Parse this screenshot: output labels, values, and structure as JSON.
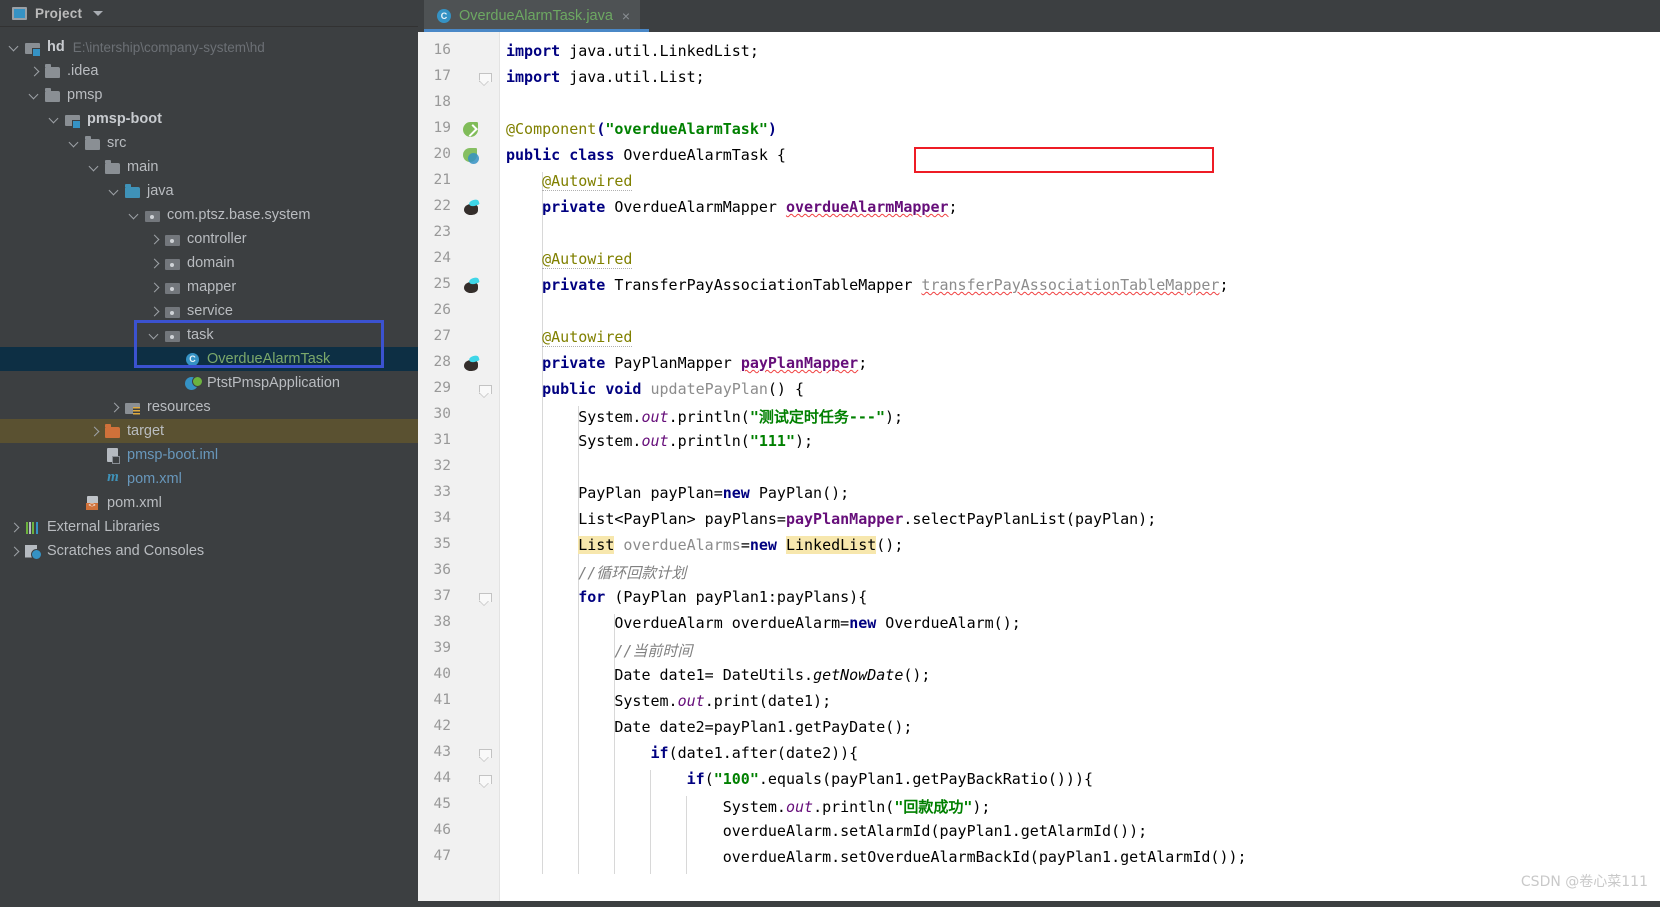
{
  "sidebar": {
    "header": {
      "title": "Project",
      "icon": "project-icon",
      "dropdown": "chevron-down-icon"
    },
    "annotation_color": "#3b52d0",
    "items": [
      {
        "label": "hd",
        "path": "E:\\intership\\company-system\\hd",
        "icon": "module-folder-icon",
        "indent": 0,
        "arrow": "open",
        "style": "bold"
      },
      {
        "label": ".idea",
        "path": "",
        "icon": "folder-icon",
        "indent": 1,
        "arrow": "closed",
        "style": "plain"
      },
      {
        "label": "pmsp",
        "path": "",
        "icon": "folder-icon",
        "indent": 1,
        "arrow": "open",
        "style": "plain"
      },
      {
        "label": "pmsp-boot",
        "path": "",
        "icon": "module-folder-icon",
        "indent": 2,
        "arrow": "open",
        "style": "bold"
      },
      {
        "label": "src",
        "path": "",
        "icon": "folder-icon",
        "indent": 3,
        "arrow": "open",
        "style": "plain"
      },
      {
        "label": "main",
        "path": "",
        "icon": "folder-icon",
        "indent": 4,
        "arrow": "open",
        "style": "plain"
      },
      {
        "label": "java",
        "path": "",
        "icon": "source-folder-icon",
        "indent": 5,
        "arrow": "open",
        "style": "plain"
      },
      {
        "label": "com.ptsz.base.system",
        "path": "",
        "icon": "package-icon",
        "indent": 6,
        "arrow": "open",
        "style": "plain"
      },
      {
        "label": "controller",
        "path": "",
        "icon": "package-icon",
        "indent": 7,
        "arrow": "closed",
        "style": "plain"
      },
      {
        "label": "domain",
        "path": "",
        "icon": "package-icon",
        "indent": 7,
        "arrow": "closed",
        "style": "plain"
      },
      {
        "label": "mapper",
        "path": "",
        "icon": "package-icon",
        "indent": 7,
        "arrow": "closed",
        "style": "plain"
      },
      {
        "label": "service",
        "path": "",
        "icon": "package-icon",
        "indent": 7,
        "arrow": "closed",
        "style": "plain"
      },
      {
        "label": "task",
        "path": "",
        "icon": "package-icon",
        "indent": 7,
        "arrow": "open",
        "style": "plain"
      },
      {
        "label": "OverdueAlarmTask",
        "path": "",
        "icon": "java-class-icon",
        "indent": 8,
        "arrow": "none",
        "style": "green-selected"
      },
      {
        "label": "PtstPmspApplication",
        "path": "",
        "icon": "spring-boot-class-icon",
        "indent": 8,
        "arrow": "none",
        "style": "plain"
      },
      {
        "label": "resources",
        "path": "",
        "icon": "resources-folder-icon",
        "indent": 5,
        "arrow": "closed",
        "style": "plain"
      },
      {
        "label": "target",
        "path": "",
        "icon": "excluded-folder-icon",
        "indent": 4,
        "arrow": "closed",
        "style": "excluded"
      },
      {
        "label": "pmsp-boot.iml",
        "path": "",
        "icon": "iml-file-icon",
        "indent": 4,
        "arrow": "none",
        "style": "blue"
      },
      {
        "label": "pom.xml",
        "path": "",
        "icon": "maven-icon",
        "indent": 4,
        "arrow": "none",
        "style": "blue"
      },
      {
        "label": "pom.xml",
        "path": "",
        "icon": "xml-file-icon",
        "indent": 3,
        "arrow": "none",
        "style": "plain"
      },
      {
        "label": "External Libraries",
        "path": "",
        "icon": "external-libraries-icon",
        "indent": 0,
        "arrow": "closed",
        "style": "plain"
      },
      {
        "label": "Scratches and Consoles",
        "path": "",
        "icon": "scratches-icon",
        "indent": 0,
        "arrow": "closed",
        "style": "plain"
      }
    ]
  },
  "editor": {
    "tab": {
      "title": "OverdueAlarmTask.java",
      "icon": "java-class-icon",
      "close": "×"
    },
    "annotation_color": "#ee1c25",
    "first_line": 16,
    "lines": [
      {
        "n": 16,
        "gutter": "",
        "fold": false,
        "html": "<span class=\"kw\">import</span><span class=\"pln\"> java.util.LinkedList;</span>"
      },
      {
        "n": 17,
        "gutter": "",
        "fold": true,
        "html": "<span class=\"kw\">import</span><span class=\"pln\"> java.util.List;</span>"
      },
      {
        "n": 18,
        "gutter": "",
        "fold": false,
        "html": ""
      },
      {
        "n": 19,
        "gutter": "spring-bean-icon",
        "fold": false,
        "html": "<span class=\"anno\">@Component</span><span class=\"kw\">(</span><span class=\"str\">\"overdueAlarmTask\"</span><span class=\"kw\">)</span>"
      },
      {
        "n": 20,
        "gutter": "spring-bean-class-icon",
        "fold": false,
        "html": "<span class=\"kw\">public class</span><span class=\"pln\"> OverdueAlarmTask {</span>"
      },
      {
        "n": 21,
        "gutter": "",
        "fold": false,
        "html": "    <span class=\"anno annou\">@Autowired</span>"
      },
      {
        "n": 22,
        "gutter": "autowired-bean-icon",
        "fold": false,
        "html": "    <span class=\"kw\">private</span><span class=\"pln\"> OverdueAlarmMapper </span><span class=\"fld sq\">overdueAlarmMapper</span><span class=\"pln\">;</span>"
      },
      {
        "n": 23,
        "gutter": "",
        "fold": false,
        "html": ""
      },
      {
        "n": 24,
        "gutter": "",
        "fold": false,
        "html": "    <span class=\"anno annou\">@Autowired</span>"
      },
      {
        "n": 25,
        "gutter": "autowired-bean-icon",
        "fold": false,
        "html": "    <span class=\"kw\">private</span><span class=\"pln\"> TransferPayAssociationTableMapper </span><span class=\"gray sq\">transferPayAssociationTableMapper</span><span class=\"pln\">;</span>"
      },
      {
        "n": 26,
        "gutter": "",
        "fold": false,
        "html": ""
      },
      {
        "n": 27,
        "gutter": "",
        "fold": false,
        "html": "    <span class=\"anno annou\">@Autowired</span>"
      },
      {
        "n": 28,
        "gutter": "autowired-bean-icon",
        "fold": false,
        "html": "    <span class=\"kw\">private</span><span class=\"pln\"> PayPlanMapper </span><span class=\"fld sq\">payPlanMapper</span><span class=\"pln\">;</span>"
      },
      {
        "n": 29,
        "gutter": "",
        "fold": true,
        "html": "    <span class=\"kw\">public void</span><span class=\"gray\"> updatePayPlan</span><span class=\"pln\">() {</span>"
      },
      {
        "n": 30,
        "gutter": "",
        "fold": false,
        "html": "        <span class=\"pln\">System.</span><span class=\"stat\">out</span><span class=\"pln\">.println(</span><span class=\"str\">\"测试定时任务---\"</span><span class=\"pln\">);</span>"
      },
      {
        "n": 31,
        "gutter": "",
        "fold": false,
        "html": "        <span class=\"pln\">System.</span><span class=\"stat\">out</span><span class=\"pln\">.println(</span><span class=\"str\">\"111\"</span><span class=\"pln\">);</span>"
      },
      {
        "n": 32,
        "gutter": "",
        "fold": false,
        "html": ""
      },
      {
        "n": 33,
        "gutter": "",
        "fold": false,
        "html": "        <span class=\"pln\">PayPlan payPlan=</span><span class=\"kw\">new</span><span class=\"pln\"> PayPlan();</span>"
      },
      {
        "n": 34,
        "gutter": "",
        "fold": false,
        "html": "        <span class=\"pln\">List&lt;PayPlan&gt; payPlans=</span><span class=\"fld\">payPlanMapper</span><span class=\"pln\">.selectPayPlanList(payPlan);</span>"
      },
      {
        "n": 35,
        "gutter": "",
        "fold": false,
        "html": "        <span class=\"pln hl\">List</span><span class=\"gray\"> overdueAlarms</span><span class=\"pln\">=</span><span class=\"kw\">new</span><span class=\"pln\"> </span><span class=\"pln hl\">LinkedList</span><span class=\"pln\">();</span>"
      },
      {
        "n": 36,
        "gutter": "",
        "fold": false,
        "html": "        <span class=\"cmt\">//循环回款计划</span>"
      },
      {
        "n": 37,
        "gutter": "",
        "fold": true,
        "html": "        <span class=\"kw\">for</span><span class=\"pln\"> (PayPlan payPlan1:payPlans){</span>"
      },
      {
        "n": 38,
        "gutter": "",
        "fold": false,
        "html": "            <span class=\"pln\">OverdueAlarm overdueAlarm=</span><span class=\"kw\">new</span><span class=\"pln\"> OverdueAlarm();</span>"
      },
      {
        "n": 39,
        "gutter": "",
        "fold": false,
        "html": "            <span class=\"cmt\">//当前时间</span>"
      },
      {
        "n": 40,
        "gutter": "",
        "fold": false,
        "html": "            <span class=\"pln\">Date date1= DateUtils.</span><span class=\"mth\">getNowDate</span><span class=\"pln\">();</span>"
      },
      {
        "n": 41,
        "gutter": "",
        "fold": false,
        "html": "            <span class=\"pln\">System.</span><span class=\"stat\">out</span><span class=\"pln\">.print(date1);</span>"
      },
      {
        "n": 42,
        "gutter": "",
        "fold": false,
        "html": "            <span class=\"pln\">Date date2=payPlan1.getPayDate();</span>"
      },
      {
        "n": 43,
        "gutter": "",
        "fold": true,
        "html": "                <span class=\"kw\">if</span><span class=\"pln\">(date1.after(date2)){</span>"
      },
      {
        "n": 44,
        "gutter": "",
        "fold": true,
        "html": "                    <span class=\"kw\">if</span><span class=\"pln\">(</span><span class=\"str\">\"100\"</span><span class=\"pln\">.equals(payPlan1.getPayBackRatio())){</span>"
      },
      {
        "n": 45,
        "gutter": "",
        "fold": false,
        "html": "                        <span class=\"pln\">System.</span><span class=\"stat\">out</span><span class=\"pln\">.println(</span><span class=\"str\">\"回款成功\"</span><span class=\"pln\">);</span>"
      },
      {
        "n": 46,
        "gutter": "",
        "fold": false,
        "html": "                        <span class=\"pln\">overdueAlarm.setAlarmId(payPlan1.getAlarmId());</span>"
      },
      {
        "n": 47,
        "gutter": "",
        "fold": false,
        "html": "                        <span class=\"pln\">overdueAlarm.setOverdueAlarmBackId(payPlan1.getAlarmId());</span>"
      }
    ]
  },
  "watermark": {
    "text": "CSDN @卷心菜111"
  }
}
